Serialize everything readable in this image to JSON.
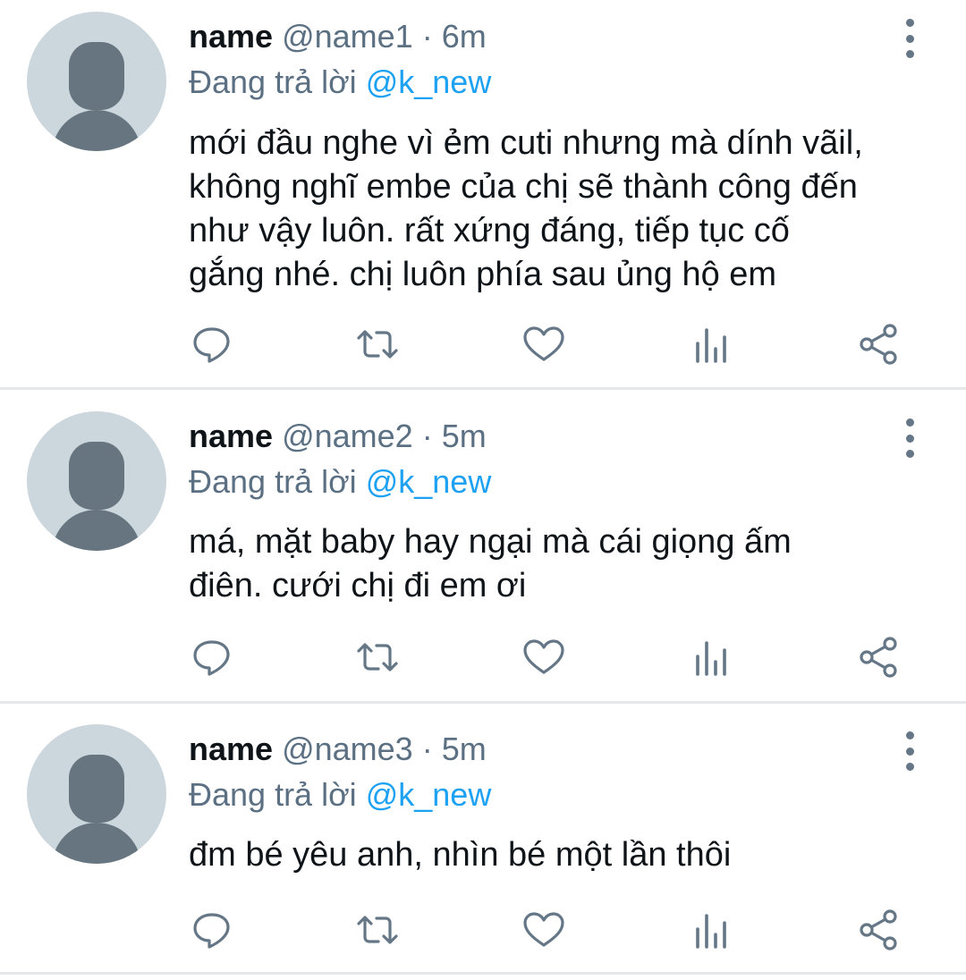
{
  "tweets": [
    {
      "display_name": "name",
      "handle": "@name1",
      "separator": "·",
      "time": "6m",
      "reply_prefix": "Đang trả lời",
      "reply_to": "@k_new",
      "lines": [
        "mới đầu nghe vì ẻm cuti nhưng mà dính vãil,",
        "không nghĩ embe của chị sẽ thành công đến",
        "như vậy luôn. rất xứng đáng, tiếp tục cố",
        "gắng nhé. chị luôn phía sau ủng hộ em"
      ]
    },
    {
      "display_name": "name",
      "handle": "@name2",
      "separator": "·",
      "time": "5m",
      "reply_prefix": "Đang trả lời",
      "reply_to": "@k_new",
      "lines": [
        "má, mặt baby hay ngại mà cái giọng ấm",
        "điên. cưới chị đi em ơi"
      ]
    },
    {
      "display_name": "name",
      "handle": "@name3",
      "separator": "·",
      "time": "5m",
      "reply_prefix": "Đang trả lời",
      "reply_to": "@k_new",
      "lines": [
        "đm bé yêu anh, nhìn bé một lần thôi"
      ]
    }
  ],
  "action_icons": [
    "reply-icon",
    "retweet-icon",
    "like-icon",
    "analytics-icon",
    "share-icon"
  ],
  "colors": {
    "text": "#0f1419",
    "secondary": "#5b7083",
    "link": "#1da1f2",
    "avatar_bg": "#ccd6dd",
    "avatar_fg": "#66757f",
    "divider": "#e4e8eb",
    "icon": "#657786"
  }
}
